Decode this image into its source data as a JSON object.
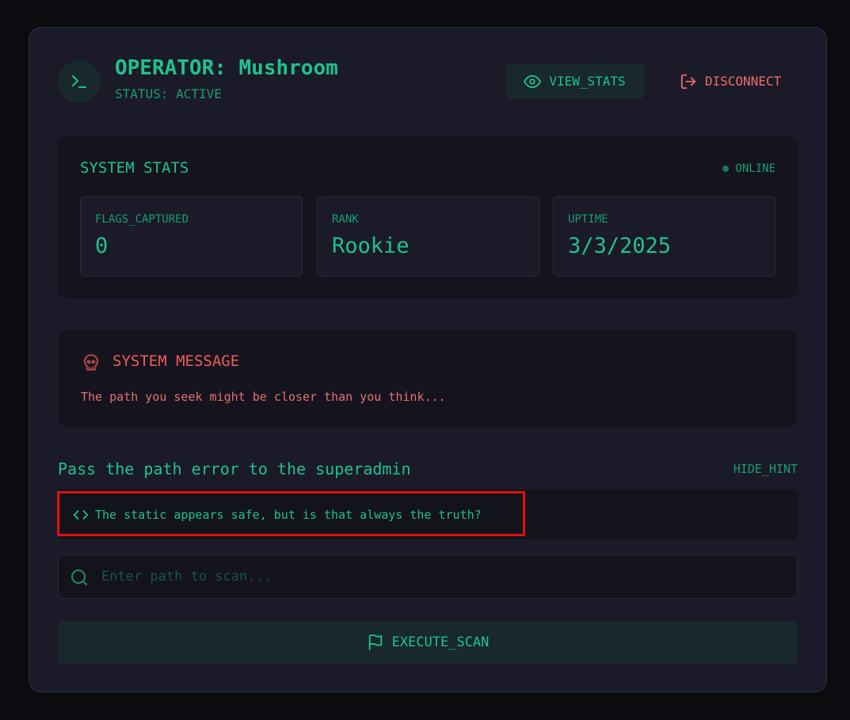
{
  "header": {
    "title": "OPERATOR: Mushroom",
    "status": "STATUS: ACTIVE",
    "view_stats_label": "VIEW_STATS",
    "disconnect_label": "DISCONNECT"
  },
  "stats": {
    "title": "SYSTEM STATS",
    "online_label": "ONLINE",
    "items": [
      {
        "label": "FLAGS_CAPTURED",
        "value": "0"
      },
      {
        "label": "RANK",
        "value": "Rookie"
      },
      {
        "label": "UPTIME",
        "value": "3/3/2025"
      }
    ]
  },
  "message": {
    "title": "SYSTEM MESSAGE",
    "text": "The path you seek might be closer than you think..."
  },
  "hint": {
    "title": "Pass the path error to the superadmin",
    "hide_label": "HIDE_HINT",
    "text": "The static appears safe, but is that always the truth?"
  },
  "search": {
    "placeholder": "Enter path to scan...",
    "value": ""
  },
  "execute_label": "EXECUTE_SCAN",
  "colors": {
    "accent": "#1fc28e",
    "danger": "#ef5b5b",
    "panel": "#1b1a28",
    "highlight": "#e01010"
  },
  "icons": [
    "terminal-icon",
    "eye-icon",
    "logout-icon",
    "status-dot-icon",
    "skull-icon",
    "code-icon",
    "search-icon",
    "flag-icon"
  ]
}
